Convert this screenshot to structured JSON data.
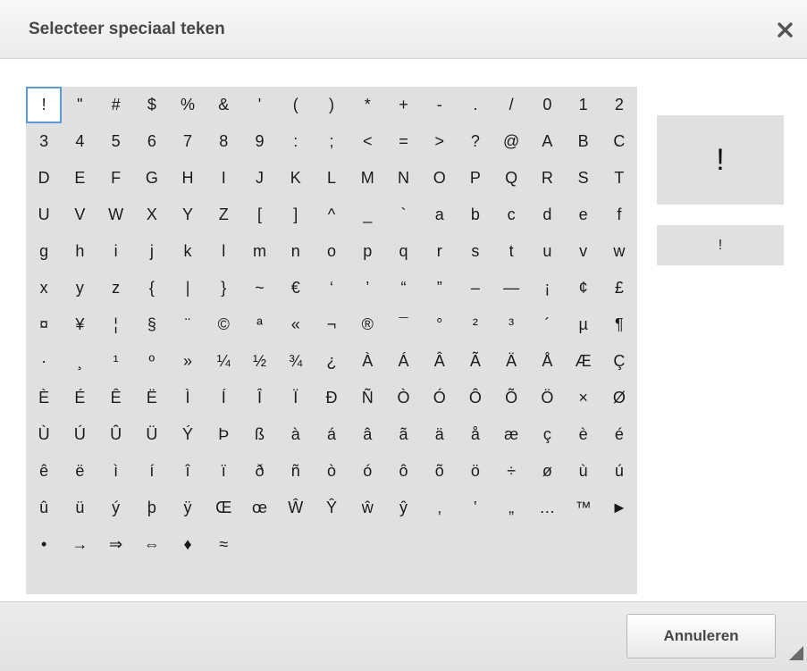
{
  "dialog": {
    "title": "Selecteer speciaal teken",
    "close_icon": "close-icon",
    "cancel_label": "Annuleren",
    "resize_icon": "resize-grip-icon"
  },
  "characters": [
    [
      "!",
      "\"",
      "#",
      "$",
      "%",
      "&",
      "'",
      "(",
      ")",
      "*",
      "+",
      "-",
      ".",
      "/",
      "0",
      "1",
      "2"
    ],
    [
      "3",
      "4",
      "5",
      "6",
      "7",
      "8",
      "9",
      ":",
      ";",
      "<",
      "=",
      ">",
      "?",
      "@",
      "A",
      "B",
      "C"
    ],
    [
      "D",
      "E",
      "F",
      "G",
      "H",
      "I",
      "J",
      "K",
      "L",
      "M",
      "N",
      "O",
      "P",
      "Q",
      "R",
      "S",
      "T"
    ],
    [
      "U",
      "V",
      "W",
      "X",
      "Y",
      "Z",
      "[",
      "]",
      "^",
      "_",
      "`",
      "a",
      "b",
      "c",
      "d",
      "e",
      "f"
    ],
    [
      "g",
      "h",
      "i",
      "j",
      "k",
      "l",
      "m",
      "n",
      "o",
      "p",
      "q",
      "r",
      "s",
      "t",
      "u",
      "v",
      "w"
    ],
    [
      "x",
      "y",
      "z",
      "{",
      "|",
      "}",
      "~",
      "€",
      "‘",
      "’",
      "“",
      "”",
      "–",
      "—",
      "¡",
      "¢",
      "£"
    ],
    [
      "¤",
      "¥",
      "¦",
      "§",
      "¨",
      "©",
      "ª",
      "«",
      "¬",
      "®",
      "¯",
      "°",
      "²",
      "³",
      "´",
      "µ",
      "¶"
    ],
    [
      "·",
      "¸",
      "¹",
      "º",
      "»",
      "¼",
      "½",
      "¾",
      "¿",
      "À",
      "Á",
      "Â",
      "Ã",
      "Ä",
      "Å",
      "Æ",
      "Ç"
    ],
    [
      "È",
      "É",
      "Ê",
      "Ë",
      "Ì",
      "Í",
      "Î",
      "Ï",
      "Ð",
      "Ñ",
      "Ò",
      "Ó",
      "Ô",
      "Õ",
      "Ö",
      "×",
      "Ø"
    ],
    [
      "Ù",
      "Ú",
      "Û",
      "Ü",
      "Ý",
      "Þ",
      "ß",
      "à",
      "á",
      "â",
      "ã",
      "ä",
      "å",
      "æ",
      "ç",
      "è",
      "é"
    ],
    [
      "ê",
      "ë",
      "ì",
      "í",
      "î",
      "ï",
      "ð",
      "ñ",
      "ò",
      "ó",
      "ô",
      "õ",
      "ö",
      "÷",
      "ø",
      "ù",
      "ú"
    ],
    [
      "û",
      "ü",
      "ý",
      "þ",
      "ÿ",
      "Œ",
      "œ",
      "Ŵ",
      "Ŷ",
      "ŵ",
      "ŷ",
      "‚",
      "‛",
      "„",
      "…",
      "™",
      "►"
    ],
    [
      "•",
      "→",
      "⇒",
      "⇔",
      "♦",
      "≈"
    ]
  ],
  "selected": "!",
  "preview": {
    "large": "!",
    "small": "!"
  },
  "colors": {
    "grid_background": "#e0e0e0",
    "selection_border": "#5b9bd5",
    "title_text": "#474747"
  }
}
